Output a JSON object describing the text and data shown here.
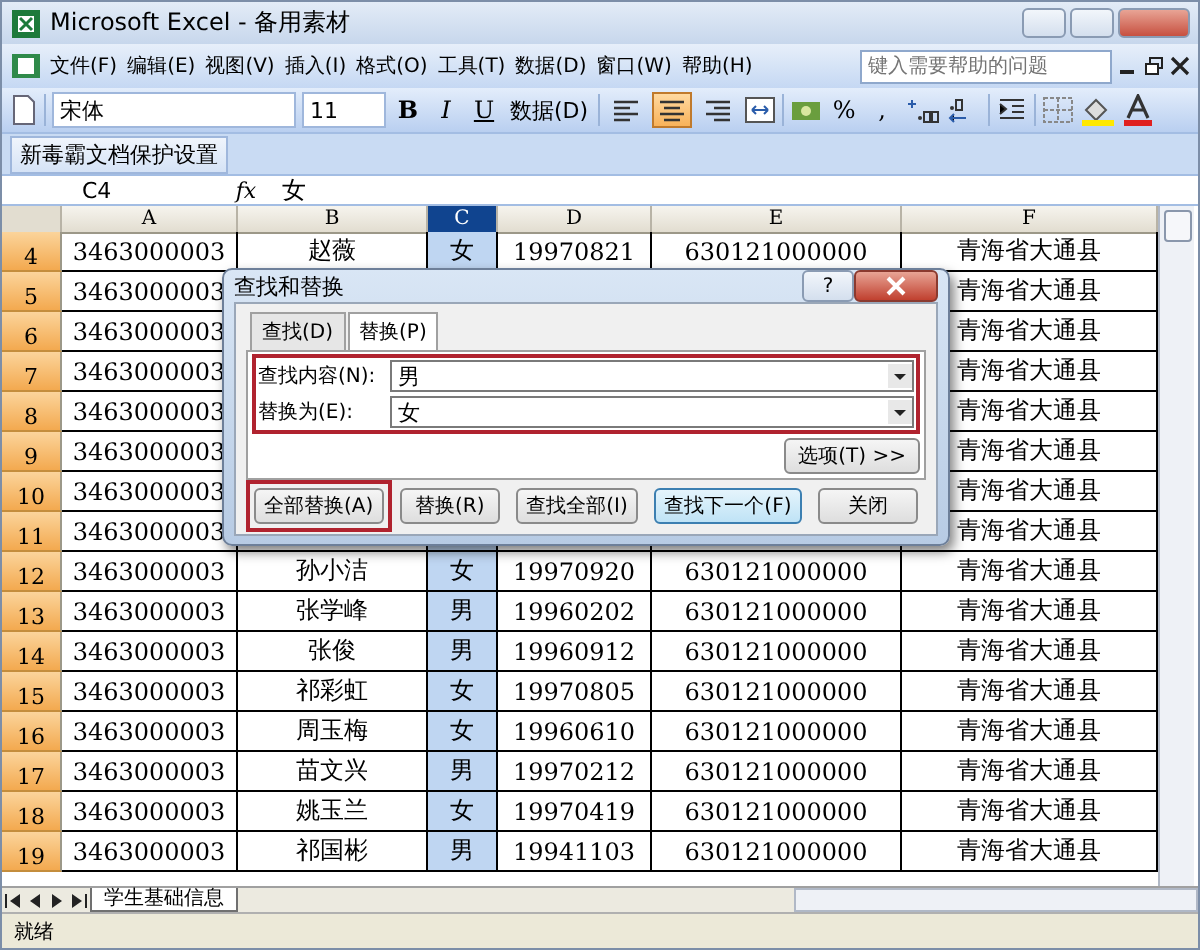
{
  "window": {
    "title": "Microsoft Excel - 备用素材"
  },
  "menu": [
    "文件(F)",
    "编辑(E)",
    "视图(V)",
    "插入(I)",
    "格式(O)",
    "工具(T)",
    "数据(D)",
    "窗口(W)",
    "帮助(H)"
  ],
  "help_box": {
    "placeholder": "键入需要帮助的问题"
  },
  "toolbar": {
    "font": "宋体",
    "size": "11",
    "bold": "B",
    "italic": "I",
    "underline": "U",
    "data_menu": "数据(D)",
    "percent": "%",
    "comma": ",",
    "align": [
      {
        "kind": "left",
        "selected": false
      },
      {
        "kind": "center",
        "selected": true
      },
      {
        "kind": "right",
        "selected": false
      }
    ]
  },
  "custom_toolbar": {
    "button": "新毒霸文档保护设置"
  },
  "formula_bar": {
    "cell": "C4",
    "function_label": "fx",
    "value": "女"
  },
  "sheet": {
    "columns": [
      {
        "label": "A",
        "selected": false
      },
      {
        "label": "B",
        "selected": false
      },
      {
        "label": "C",
        "selected": true
      },
      {
        "label": "D",
        "selected": false
      },
      {
        "label": "E",
        "selected": false
      },
      {
        "label": "F",
        "selected": false
      }
    ],
    "rows": [
      {
        "number": "4",
        "cells": [
          "3463000003",
          "赵薇",
          "女",
          "19970821",
          "630121000000",
          "青海省大通县"
        ]
      },
      {
        "number": "5",
        "cells": [
          "3463000003",
          null,
          null,
          null,
          null,
          "青海省大通县"
        ]
      },
      {
        "number": "6",
        "cells": [
          "3463000003",
          null,
          null,
          null,
          null,
          "青海省大通县"
        ]
      },
      {
        "number": "7",
        "cells": [
          "3463000003",
          null,
          null,
          null,
          null,
          "青海省大通县"
        ]
      },
      {
        "number": "8",
        "cells": [
          "3463000003",
          null,
          null,
          null,
          null,
          "青海省大通县"
        ]
      },
      {
        "number": "9",
        "cells": [
          "3463000003",
          null,
          null,
          null,
          null,
          "青海省大通县"
        ]
      },
      {
        "number": "10",
        "cells": [
          "3463000003",
          null,
          null,
          null,
          null,
          "青海省大通县"
        ]
      },
      {
        "number": "11",
        "cells": [
          "3463000003",
          null,
          null,
          null,
          null,
          "青海省大通县"
        ]
      },
      {
        "number": "12",
        "cells": [
          "3463000003",
          "孙小洁",
          "女",
          "19970920",
          "630121000000",
          "青海省大通县"
        ]
      },
      {
        "number": "13",
        "cells": [
          "3463000003",
          "张学峰",
          "男",
          "19960202",
          "630121000000",
          "青海省大通县"
        ]
      },
      {
        "number": "14",
        "cells": [
          "3463000003",
          "张俊",
          "男",
          "19960912",
          "630121000000",
          "青海省大通县"
        ]
      },
      {
        "number": "15",
        "cells": [
          "3463000003",
          "祁彩虹",
          "女",
          "19970805",
          "630121000000",
          "青海省大通县"
        ]
      },
      {
        "number": "16",
        "cells": [
          "3463000003",
          "周玉梅",
          "女",
          "19960610",
          "630121000000",
          "青海省大通县"
        ]
      },
      {
        "number": "17",
        "cells": [
          "3463000003",
          "苗文兴",
          "男",
          "19970212",
          "630121000000",
          "青海省大通县"
        ]
      },
      {
        "number": "18",
        "cells": [
          "3463000003",
          "姚玉兰",
          "女",
          "19970419",
          "630121000000",
          "青海省大通县"
        ]
      },
      {
        "number": "19",
        "cells": [
          "3463000003",
          "祁国彬",
          "男",
          "19941103",
          "630121000000",
          "青海省大通县"
        ]
      }
    ]
  },
  "dialog": {
    "title": "查找和替换",
    "help_label": "?",
    "tabs": [
      {
        "label": "查找(D)",
        "selected": false
      },
      {
        "label": "替换(P)",
        "selected": true
      }
    ],
    "fields_highlighted": true,
    "fields": [
      {
        "label": "查找内容(N):",
        "value": "男"
      },
      {
        "label": "替换为(E):",
        "value": "女"
      }
    ],
    "options_button": "选项(T) >>",
    "buttons": [
      {
        "label": "全部替换(A)",
        "highlighted": true,
        "default": false
      },
      {
        "label": "替换(R)",
        "highlighted": false,
        "default": false
      },
      {
        "label": "查找全部(I)",
        "highlighted": false,
        "default": false
      },
      {
        "label": "查找下一个(F)",
        "highlighted": false,
        "default": true
      },
      {
        "label": "关闭",
        "highlighted": false,
        "default": false
      }
    ]
  },
  "sheet_tabs": [
    {
      "label": "学生基础信息",
      "selected": true
    }
  ],
  "status_bar": {
    "text": "就绪"
  }
}
